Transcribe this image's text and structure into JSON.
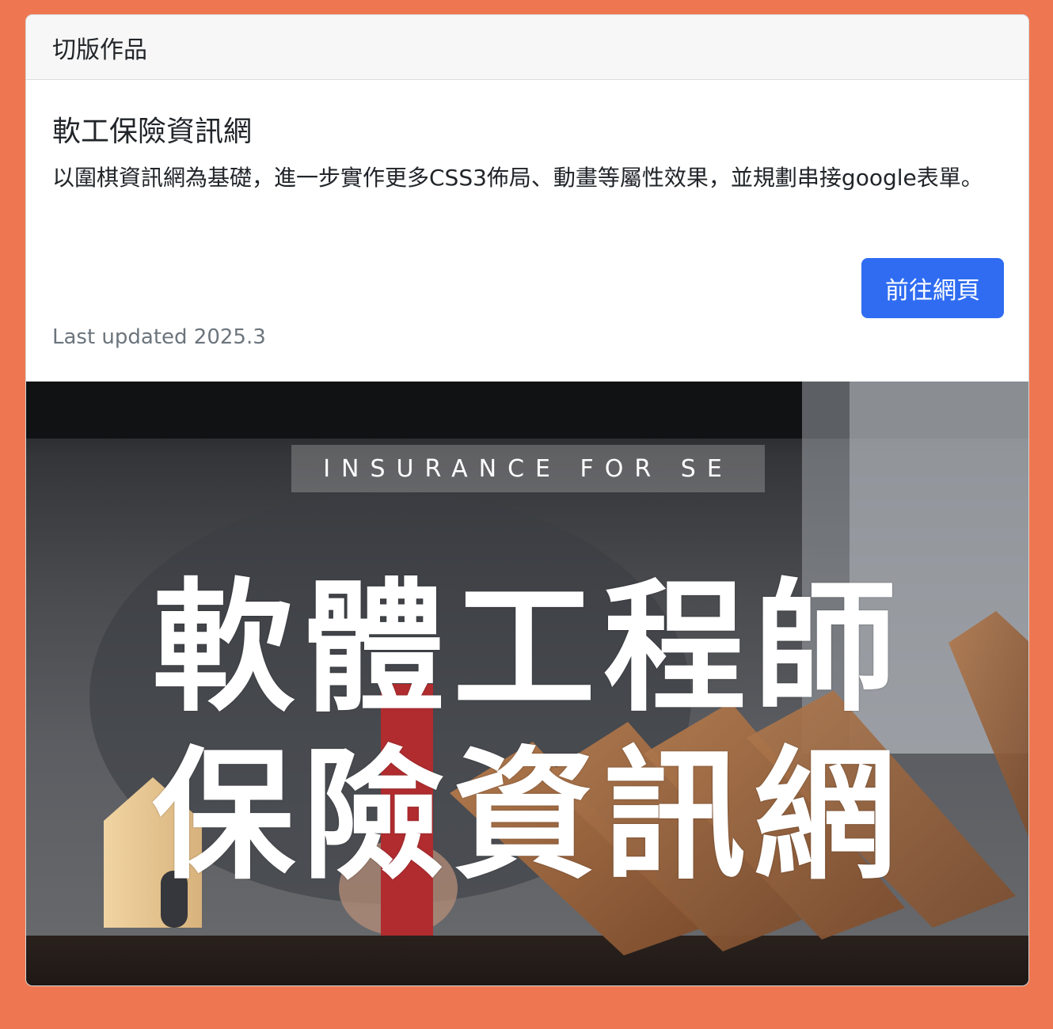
{
  "card": {
    "header": "切版作品",
    "title": "軟工保險資訊網",
    "description": "以圍棋資訊網為基礎，進一步實作更多CSS3佈局、動畫等屬性效果，並規劃串接google表單。",
    "button_label": "前往網頁",
    "last_updated": "Last updated 2025.3"
  },
  "banner": {
    "tag": "INSURANCE FOR SE",
    "line1": "軟體工程師",
    "line2": "保險資訊網"
  },
  "colors": {
    "page_background": "#ee7752",
    "button_background": "#2f6cf2",
    "muted_text": "#6c757d"
  }
}
